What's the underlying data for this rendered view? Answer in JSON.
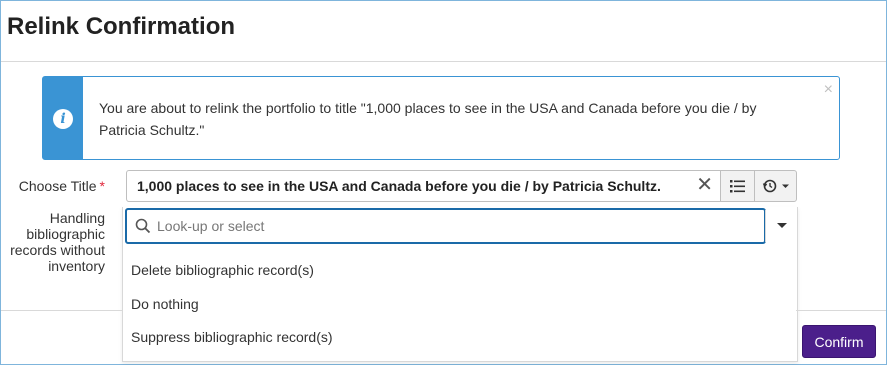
{
  "dialog": {
    "title": "Relink Confirmation"
  },
  "info": {
    "message": "You are about to relink the portfolio to title \"1,000 places to see in the USA and Canada before you die / by Patricia Schultz.\"",
    "close_glyph": "×",
    "icon": "info-icon",
    "accent": "#3a94d4"
  },
  "form": {
    "choose_title_label": "Choose Title",
    "required_marker": "*",
    "title_value": "1,000 places to see in the USA and Canada before you die / by Patricia Schultz.",
    "clear_glyph": "✕",
    "handling_label": "Handling bibliographic records without inventory",
    "lookup_placeholder": "Look-up or select",
    "options": [
      "Delete bibliographic record(s)",
      "Do nothing",
      "Suppress bibliographic record(s)"
    ]
  },
  "footer": {
    "confirm_label": "Confirm",
    "confirm_color": "#4b1f8b"
  }
}
